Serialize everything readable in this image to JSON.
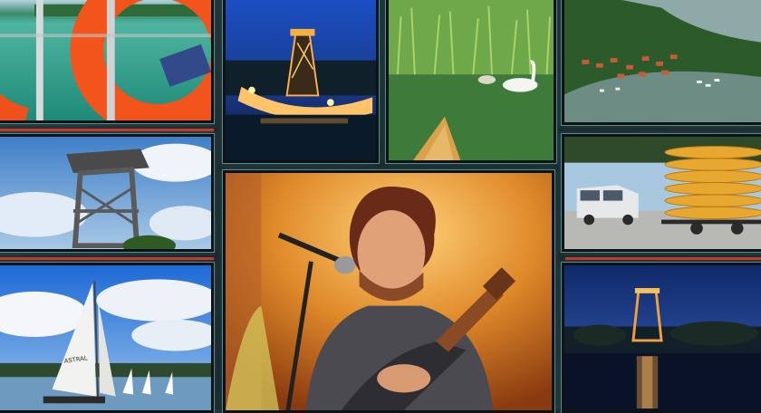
{
  "collage": {
    "tiles": [
      {
        "id": "lifebuoy",
        "label": ""
      },
      {
        "id": "night-tower",
        "label": ""
      },
      {
        "id": "swans",
        "label": ""
      },
      {
        "id": "aerial-lake",
        "label": ""
      },
      {
        "id": "observation-tower",
        "label": ""
      },
      {
        "id": "singer",
        "label": ""
      },
      {
        "id": "kayak-trailer",
        "label": ""
      },
      {
        "id": "sailboat",
        "label": ""
      },
      {
        "id": "night-reflection",
        "label": ""
      }
    ],
    "sail_text": "ASTRAL",
    "colors": {
      "frame": "#0d1314",
      "glow": "#4a8e96",
      "accent_stripe": "#c43a2a"
    }
  }
}
